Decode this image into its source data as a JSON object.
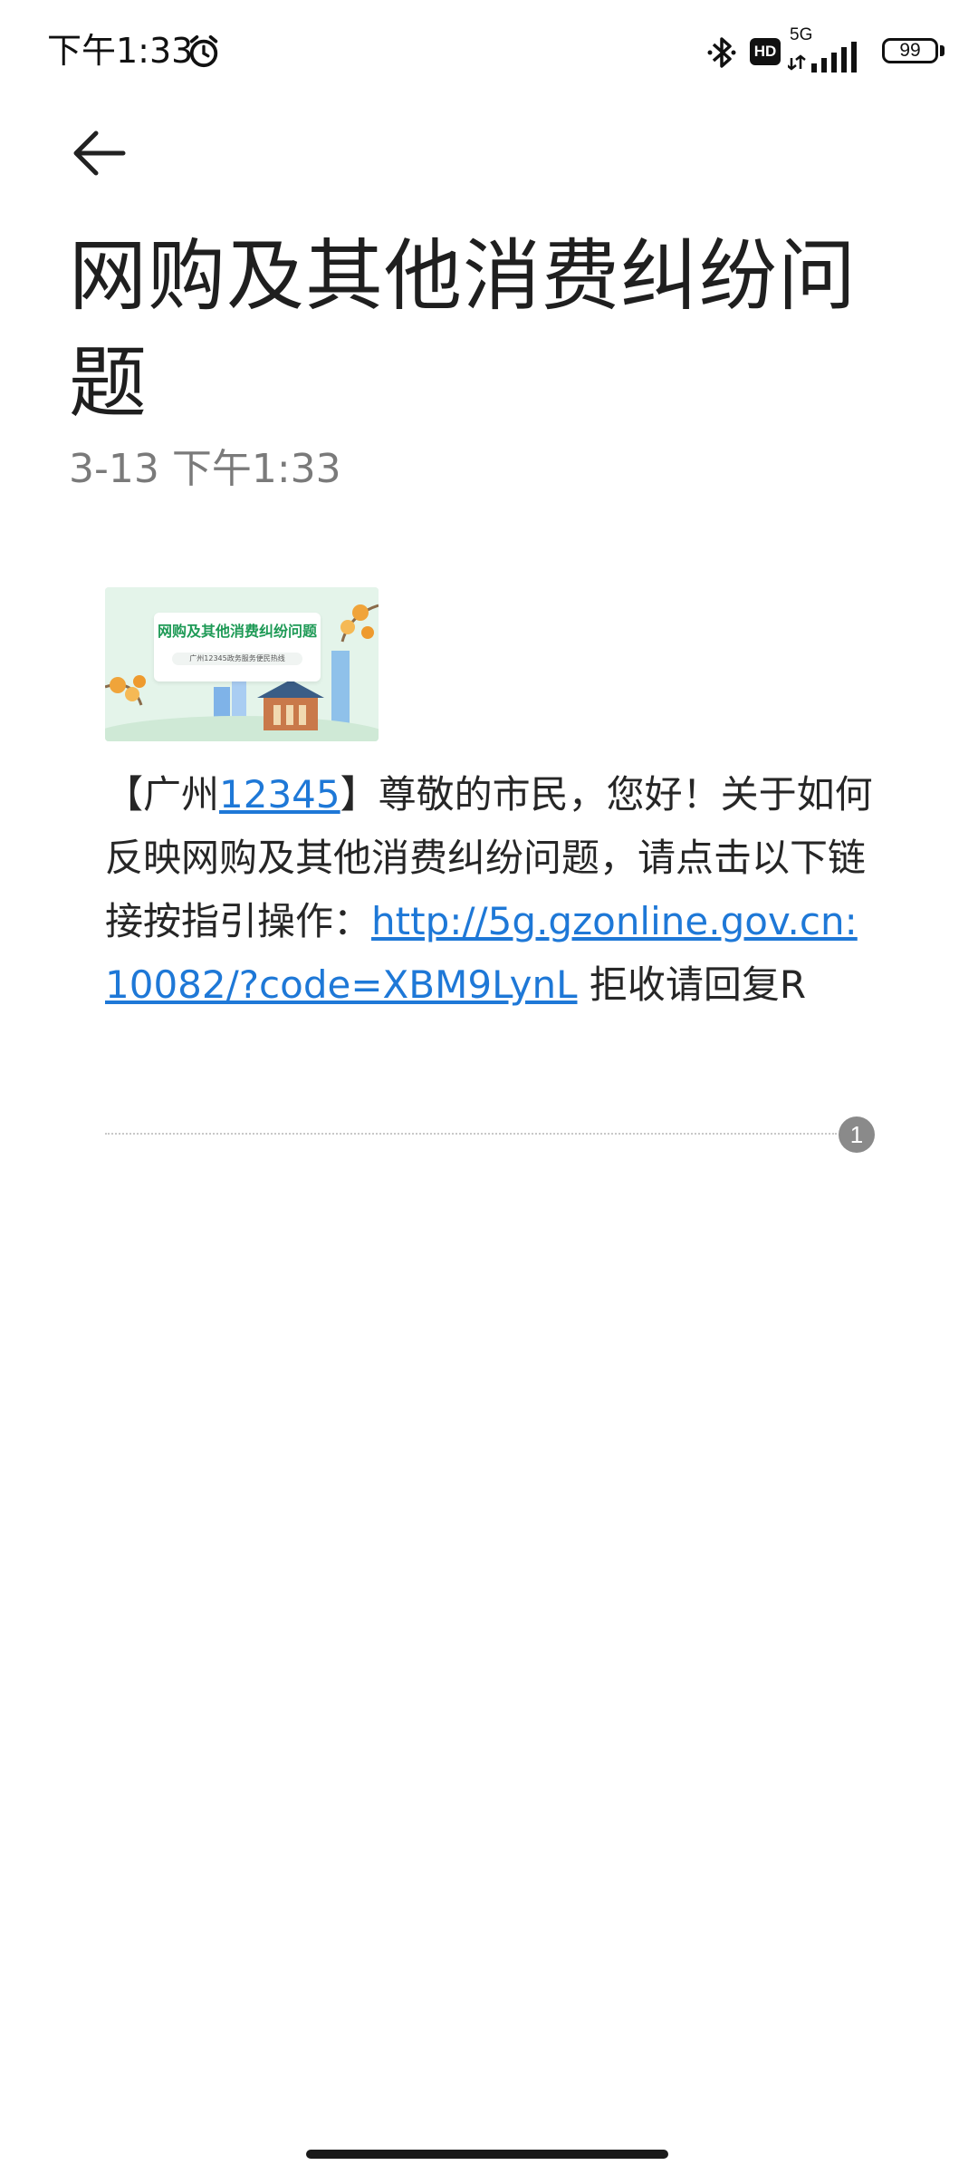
{
  "status_bar": {
    "time": "下午1:33",
    "network": "5G",
    "hd_badge": "HD",
    "battery_level": "99",
    "icons": [
      "alarm-icon",
      "bluetooth-icon",
      "hd-voice-icon",
      "signal-icon",
      "battery-icon"
    ]
  },
  "header": {
    "back_icon": "back-arrow-icon",
    "title": "网购及其他消费纠纷问题",
    "subtitle": "3-13 下午1:33"
  },
  "message": {
    "banner": {
      "title": "网购及其他消费纠纷问题",
      "subtitle": "广州12345政务服务便民热线"
    },
    "text_prefix": "【广州",
    "hotline_link": "12345",
    "text_middle": "】尊敬的市民，您好！关于如何反映网购及其他消费纠纷问题，请点击以下链接按指引操作：",
    "url_link": "http://5g.gzonline.gov.cn:10082/?code=XBM9LynL",
    "text_suffix": " 拒收请回复R",
    "sim_slot": "1"
  },
  "colors": {
    "link": "#1e78d7",
    "subtitle": "#7a7a7a",
    "badge": "#8a8a8a"
  }
}
